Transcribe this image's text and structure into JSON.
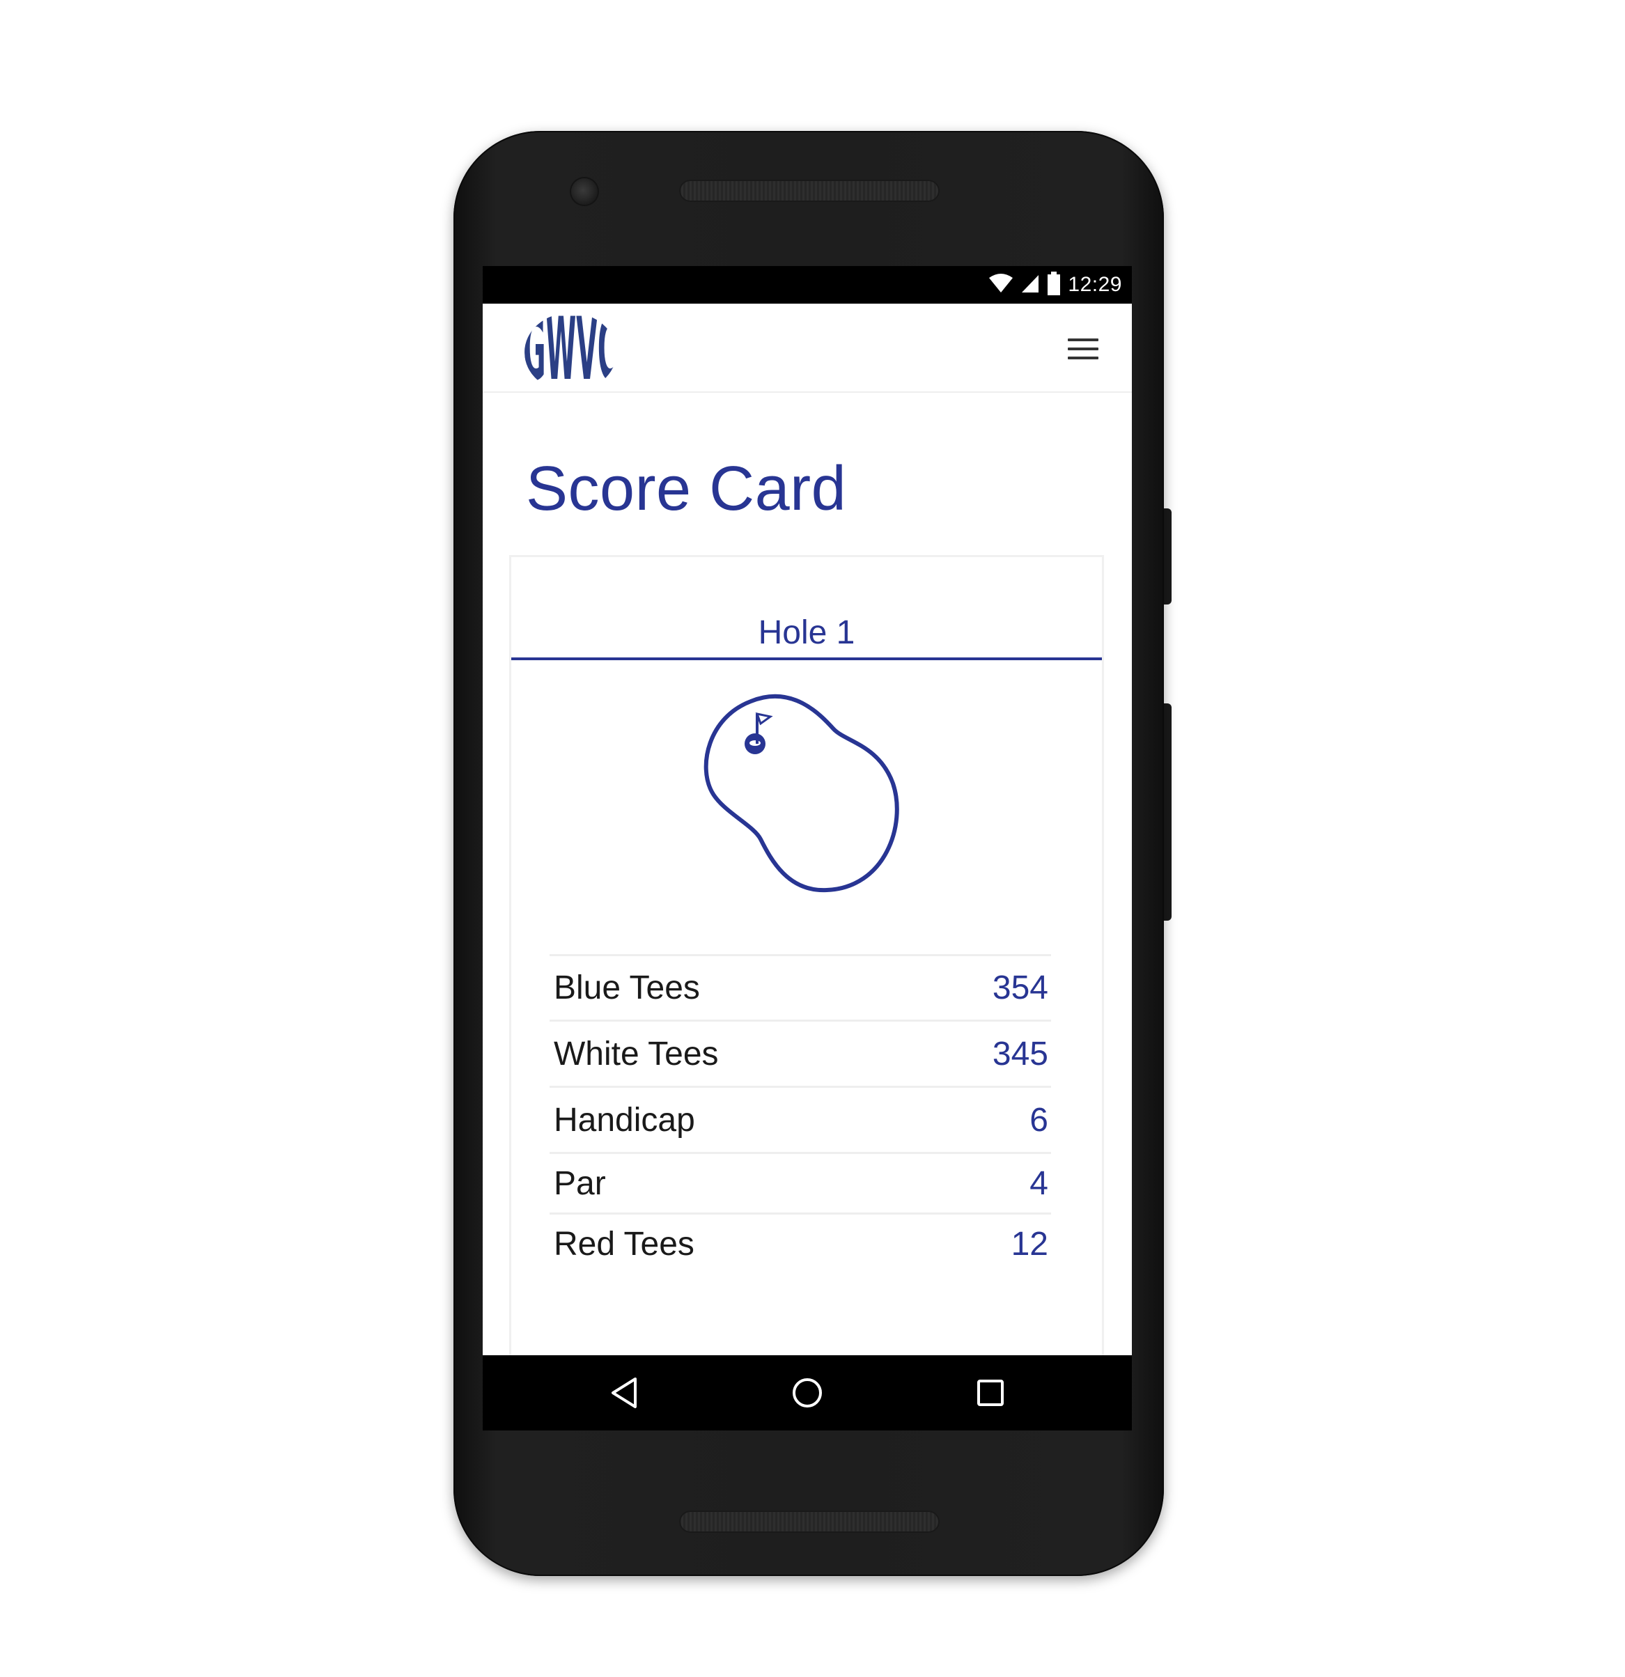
{
  "status_bar": {
    "time": "12:29",
    "icons": [
      "wifi-icon",
      "cell-signal-icon",
      "battery-icon"
    ]
  },
  "app_bar": {
    "logo_text": "GWVC",
    "menu_icon": "hamburger-menu-icon"
  },
  "page": {
    "title": "Score Card"
  },
  "card": {
    "hole_tab_label": "Hole 1",
    "map_icon": "golf-green-flag-icon",
    "stats": [
      {
        "label": "Blue Tees",
        "value": "354"
      },
      {
        "label": "White Tees",
        "value": "345"
      },
      {
        "label": "Handicap",
        "value": "6"
      },
      {
        "label": "Par",
        "value": "4"
      },
      {
        "label": "Red Tees",
        "value": "12"
      }
    ]
  },
  "nav_bar": {
    "back_icon": "back-triangle-icon",
    "home_icon": "home-circle-icon",
    "recent_icon": "recent-apps-square-icon"
  },
  "colors": {
    "accent": "#283593",
    "logo": "#2b3f85",
    "phone_body": "#1e1e1e",
    "divider": "#eeeeee"
  }
}
